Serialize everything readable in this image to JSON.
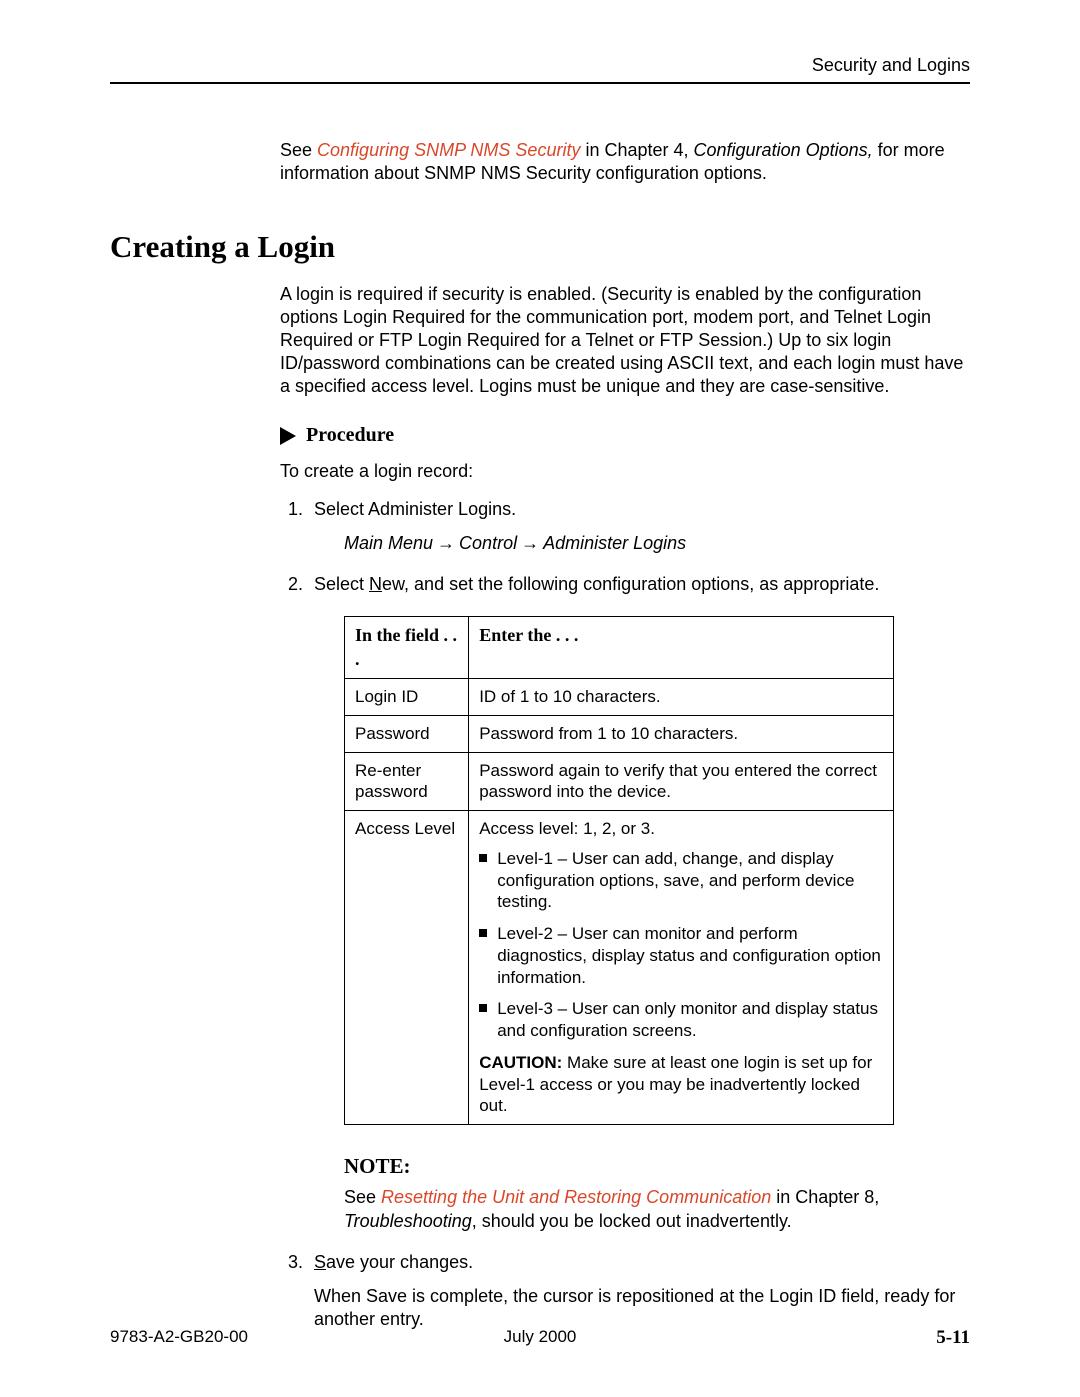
{
  "header": {
    "title": "Security and Logins"
  },
  "intro": {
    "pre": "See ",
    "link": "Configuring SNMP NMS Security",
    "mid": " in Chapter 4, ",
    "chapref": "Configuration Options,",
    "post": " for more information about SNMP NMS Security configuration options."
  },
  "section_title": "Creating a Login",
  "section_body": "A login is required if security is enabled. (Security is enabled by the configuration options Login Required for the communication port, modem port, and Telnet Login Required or FTP Login Required for a Telnet or FTP Session.) Up to six login ID/password combinations can be created using ASCII text, and each login must have a specified access level. Logins must be unique and they are case-sensitive.",
  "procedure": {
    "label": "Procedure",
    "intro": "To create a login record:",
    "step1": "Select Administer Logins.",
    "navpath": {
      "a": "Main Menu",
      "b": "Control",
      "c": "Administer Logins"
    },
    "step2_pre": "Select ",
    "step2_u": "N",
    "step2_post": "ew, and set the following configuration options, as appropriate.",
    "step3_pre_u": "S",
    "step3_post": "ave your changes.",
    "step3_follow": "When Save is complete, the cursor is repositioned at the Login ID field, ready for another entry."
  },
  "table": {
    "h1": "In the field . . .",
    "h2": "Enter the . . .",
    "rows": [
      {
        "f": "Login ID",
        "v": "ID of 1 to 10 characters."
      },
      {
        "f": "Password",
        "v": "Password from 1 to 10 characters."
      },
      {
        "f": "Re-enter password",
        "v": "Password again to verify that you entered the correct password into the device."
      }
    ],
    "access": {
      "f": "Access Level",
      "lead": "Access level: 1, 2, or 3.",
      "l1": "Level-1 – User can add, change, and display configuration options, save, and perform device testing.",
      "l2": "Level-2 – User can monitor and perform diagnostics, display status and configuration option information.",
      "l3": "Level-3 – User can only monitor and display status and configuration screens.",
      "caution_label": "CAUTION:",
      "caution_text": " Make sure at least one login is set up for Level-1 access or you may be inadvertently locked out."
    }
  },
  "note": {
    "heading": "NOTE:",
    "pre": "See ",
    "link": "Resetting the Unit and Restoring Communication",
    "mid": " in Chapter 8, ",
    "chapref": "Troubleshooting",
    "post": ", should you be locked out inadvertently."
  },
  "footer": {
    "docnum": "9783-A2-GB20-00",
    "date": "July 2000",
    "pagenum": "5-11"
  }
}
